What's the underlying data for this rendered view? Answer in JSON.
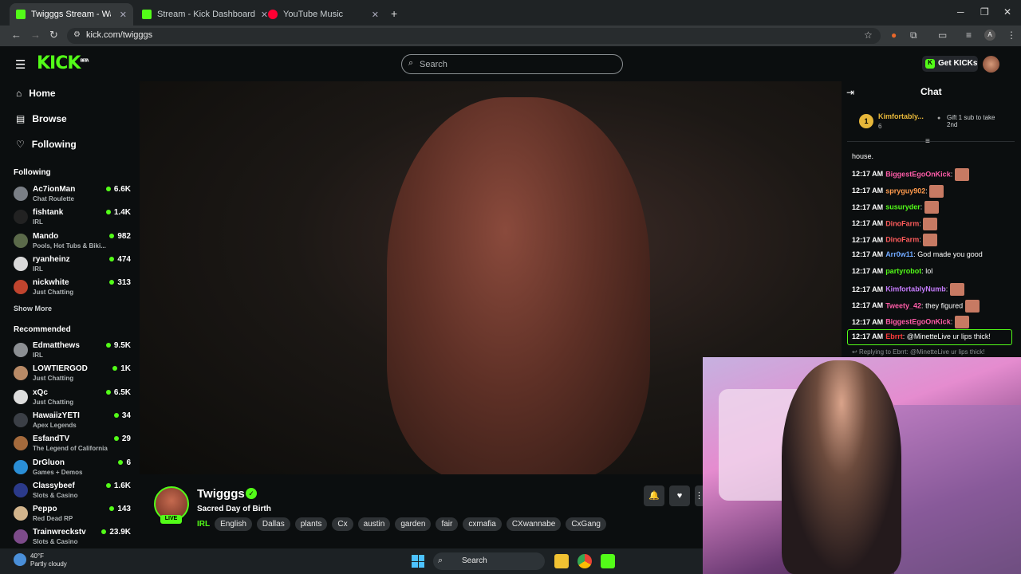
{
  "browser": {
    "tabs": [
      {
        "label": "Twigggs Stream - Watch Li",
        "active": true,
        "icon": "kick-favicon"
      },
      {
        "label": "Stream - Kick Dashboard",
        "active": false,
        "icon": "kick-favicon"
      },
      {
        "label": "YouTube Music",
        "active": false,
        "icon": "youtube-music-favicon"
      }
    ],
    "url": "kick.com/twigggs"
  },
  "kick": {
    "logo": "KICK",
    "logo_badge": "BETA",
    "search_placeholder": "Search",
    "get_kicks": "Get KICKs"
  },
  "sidebar": {
    "nav": [
      {
        "label": "Home",
        "icon": "home-icon"
      },
      {
        "label": "Browse",
        "icon": "browse-icon"
      },
      {
        "label": "Following",
        "icon": "heart-icon"
      }
    ],
    "following_title": "Following",
    "following": [
      {
        "name": "Ac7ionMan",
        "category": "Chat Roulette",
        "viewers": "6.6K",
        "color": "#7a7f86"
      },
      {
        "name": "fishtank",
        "category": "IRL",
        "viewers": "1.4K",
        "color": "#222"
      },
      {
        "name": "Mando",
        "category": "Pools, Hot Tubs & Biki...",
        "viewers": "982",
        "color": "#5b6a4a"
      },
      {
        "name": "ryanheinz",
        "category": "IRL",
        "viewers": "474",
        "color": "#d9d9d9"
      },
      {
        "name": "nickwhite",
        "category": "Just Chatting",
        "viewers": "313",
        "color": "#c0442e"
      }
    ],
    "show_more": "Show More",
    "recommended_title": "Recommended",
    "recommended": [
      {
        "name": "Edmatthews",
        "category": "IRL",
        "viewers": "9.5K",
        "color": "#8c8f93"
      },
      {
        "name": "LOWTIERGOD",
        "category": "Just Chatting",
        "viewers": "1K",
        "color": "#b88a66"
      },
      {
        "name": "xQc",
        "category": "Just Chatting",
        "viewers": "6.5K",
        "color": "#ddd"
      },
      {
        "name": "HawaiizYETI",
        "category": "Apex Legends",
        "viewers": "34",
        "color": "#3b3f46"
      },
      {
        "name": "EsfandTV",
        "category": "The Legend of California",
        "viewers": "29",
        "color": "#a46a3c"
      },
      {
        "name": "DrGluon",
        "category": "Games + Demos",
        "viewers": "6",
        "color": "#2a8ed6"
      },
      {
        "name": "Classybeef",
        "category": "Slots & Casino",
        "viewers": "1.6K",
        "color": "#2b3a8a"
      },
      {
        "name": "Peppo",
        "category": "Red Dead RP",
        "viewers": "143",
        "color": "#d2b48c"
      },
      {
        "name": "Trainwreckstv",
        "category": "Slots & Casino",
        "viewers": "23.9K",
        "color": "#7d4b8a"
      }
    ]
  },
  "stream": {
    "name": "Twigggs",
    "title": "Sacred Day of Birth",
    "live": "LIVE",
    "category": "IRL",
    "tags": [
      "English",
      "Dallas",
      "plants",
      "Cx",
      "austin",
      "garden",
      "fair",
      "cxmafia",
      "CXwannabe",
      "CxGang"
    ]
  },
  "chat": {
    "title": "Chat",
    "leader": {
      "name": "Kimfortably...",
      "rank": "1",
      "count": "6",
      "gift_text": "Gift 1 sub to take 2nd"
    },
    "first_line": "house.",
    "messages": [
      {
        "time": "12:17 AM",
        "user": "BiggestEgoOnKick",
        "color": "#ff5ca8",
        "text": "",
        "emote": true
      },
      {
        "time": "12:17 AM",
        "user": "spryguy902",
        "color": "#ff9a4d",
        "text": "",
        "emote": true
      },
      {
        "time": "12:17 AM",
        "user": "susuryder",
        "color": "#53fc18",
        "text": "",
        "emote": true
      },
      {
        "time": "12:17 AM",
        "user": "DinoFarm",
        "color": "#ff5c5c",
        "text": "",
        "emote": true
      },
      {
        "time": "12:17 AM",
        "user": "DinoFarm",
        "color": "#ff5c5c",
        "text": "",
        "emote": true
      },
      {
        "time": "12:17 AM",
        "user": "Arr0w11",
        "color": "#6fa8ff",
        "text": "God made you good",
        "emote": false
      },
      {
        "time": "12:17 AM",
        "user": "partyrobot",
        "color": "#53fc18",
        "text": "lol",
        "emote": false
      },
      {
        "time": "12:17 AM",
        "user": "KimfortablyNumb",
        "color": "#c77dff",
        "text": "",
        "emote": true
      },
      {
        "time": "12:17 AM",
        "user": "Tweety_42",
        "color": "#ff5ca8",
        "text": "they figured",
        "emote": true
      },
      {
        "time": "12:17 AM",
        "user": "BiggestEgoOnKick",
        "color": "#ff5ca8",
        "text": "",
        "emote": true
      },
      {
        "time": "12:17 AM",
        "user": "Ebrrt",
        "color": "#ff3b3b",
        "text": "@MinetteLive ur lips thick!",
        "emote": false
      }
    ],
    "replying": "Replying to Ebrrt: @MinetteLive ur lips thick!"
  },
  "taskbar": {
    "temp": "40°F",
    "weather": "Partly cloudy",
    "search": "Search"
  },
  "colors": {
    "accent": "#53fc18",
    "bg": "#0b0e0f"
  }
}
